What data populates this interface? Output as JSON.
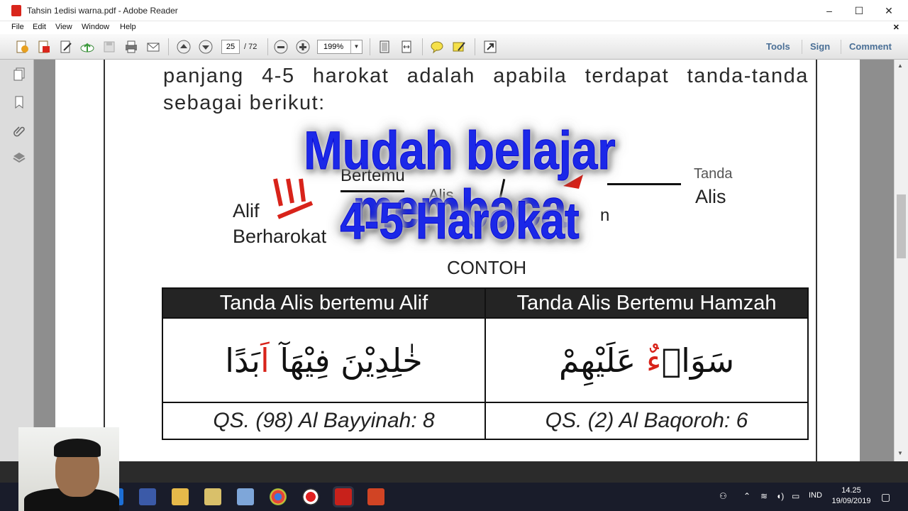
{
  "window": {
    "title": "Tahsin 1edisi warna.pdf - Adobe Reader",
    "minimize": "–",
    "maximize": "☐",
    "close": "✕"
  },
  "menu": {
    "items": [
      "File",
      "Edit",
      "View",
      "Window",
      "Help"
    ],
    "close_doc": "✕"
  },
  "toolbar": {
    "page_current": "25",
    "page_total": "/ 72",
    "zoom": "199%",
    "zoom_dropdown": "▼",
    "right_links": [
      "Tools",
      "Sign",
      "Comment"
    ]
  },
  "document": {
    "para_line1": [
      "panjang",
      "4-5",
      "harokat",
      "adalah",
      "apabila",
      "terdapat",
      "tanda-tanda"
    ],
    "para_line2": "sebagai berikut:",
    "diagram": {
      "left_label_1": "Alif",
      "left_label_2": "Berharokat",
      "mid_label_1": "Bertemu",
      "mid_label_2": "Alis",
      "right_label_top": "Tanda",
      "right_label": "Alis",
      "partial_n": "n",
      "caption": "CONTOH"
    },
    "table": {
      "headers": [
        "Tanda Alis bertemu Alif",
        "Tanda Alis Bertemu Hamzah"
      ],
      "arabic_left": [
        "خٰلِدِيْنَ فِيْهَآ ",
        "اَ",
        "بَدًا"
      ],
      "arabic_right": [
        "سَوَا",
        "ۤءٌ",
        " عَلَيْهِمْ"
      ],
      "references": [
        "QS. (98) Al Bayyinah: 8",
        "QS. (2) Al Baqoroh: 6"
      ]
    }
  },
  "overlay": {
    "line1": "Mudah belajar membaca",
    "line2": "4-5 Harokat"
  },
  "taskbar": {
    "language": "IND",
    "time": "14.25",
    "date": "19/09/2019"
  },
  "colors": {
    "overlay_text": "#1b28e8",
    "arabic_highlight": "#d8231a",
    "table_header_bg": "#242424"
  }
}
